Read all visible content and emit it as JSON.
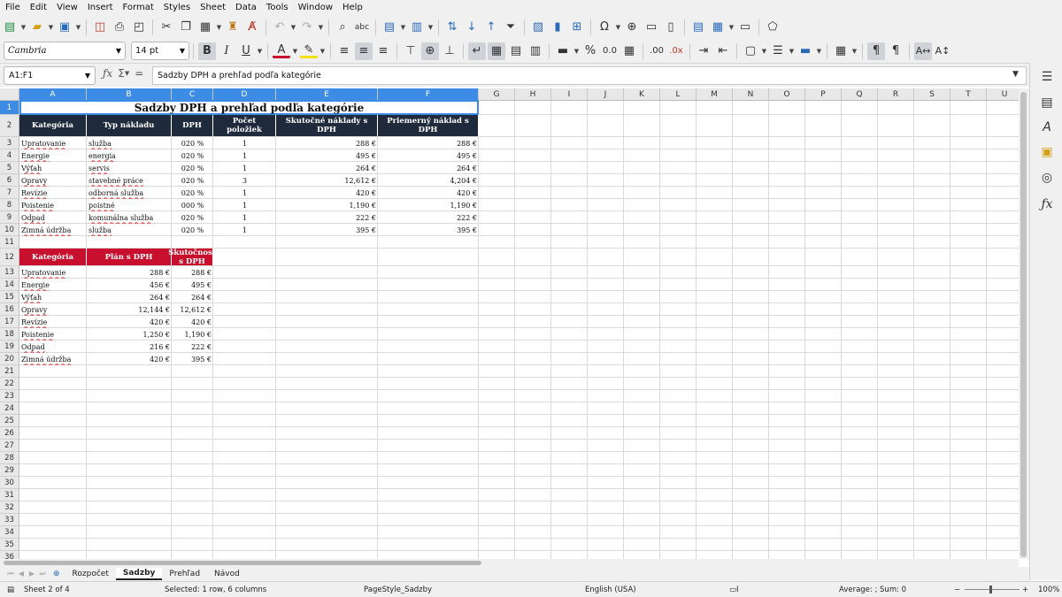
{
  "menu": [
    "File",
    "Edit",
    "View",
    "Insert",
    "Format",
    "Styles",
    "Sheet",
    "Data",
    "Tools",
    "Window",
    "Help"
  ],
  "font": {
    "name": "Cambria",
    "size": "14 pt"
  },
  "namebox": "A1:F1",
  "formula": "Sadzby DPH a prehľad podľa kategórie",
  "columns": [
    {
      "l": "A",
      "w": 76
    },
    {
      "l": "B",
      "w": 96
    },
    {
      "l": "C",
      "w": 47
    },
    {
      "l": "D",
      "w": 71
    },
    {
      "l": "E",
      "w": 115
    },
    {
      "l": "F",
      "w": 114
    },
    {
      "l": "G",
      "w": 41
    },
    {
      "l": "H",
      "w": 41
    },
    {
      "l": "I",
      "w": 41
    },
    {
      "l": "J",
      "w": 41
    },
    {
      "l": "K",
      "w": 41
    },
    {
      "l": "L",
      "w": 41
    },
    {
      "l": "M",
      "w": 41
    },
    {
      "l": "N",
      "w": 41
    },
    {
      "l": "O",
      "w": 41
    },
    {
      "l": "P",
      "w": 41
    },
    {
      "l": "Q",
      "w": 41
    },
    {
      "l": "R",
      "w": 41
    },
    {
      "l": "S",
      "w": 41
    },
    {
      "l": "T",
      "w": 41
    },
    {
      "l": "U",
      "w": 41
    }
  ],
  "title": "Sadzby DPH a prehľad podľa kategórie",
  "table1": {
    "headers": [
      "Kategória",
      "Typ nákladu",
      "DPH",
      "Počet položiek",
      "Skutočné náklady s DPH",
      "Priemerný náklad s DPH"
    ],
    "rows": [
      [
        "Upratovanie",
        "služba",
        "020 %",
        "1",
        "288 €",
        "288 €"
      ],
      [
        "Energie",
        "energia",
        "020 %",
        "1",
        "495 €",
        "495 €"
      ],
      [
        "Výťah",
        "servis",
        "020 %",
        "1",
        "264 €",
        "264 €"
      ],
      [
        "Opravy",
        "stavebné práce",
        "020 %",
        "3",
        "12,612 €",
        "4,204 €"
      ],
      [
        "Revízie",
        "odborná služba",
        "020 %",
        "1",
        "420 €",
        "420 €"
      ],
      [
        "Poistenie",
        "poistné",
        "000 %",
        "1",
        "1,190 €",
        "1,190 €"
      ],
      [
        "Odpad",
        "komunálna služba",
        "020 %",
        "1",
        "222 €",
        "222 €"
      ],
      [
        "Zimná údržba",
        "služba",
        "020 %",
        "1",
        "395 €",
        "395 €"
      ]
    ]
  },
  "table2": {
    "headers": [
      "Kategória",
      "Plán s DPH",
      "Skutočnosť s DPH"
    ],
    "rows": [
      [
        "Upratovanie",
        "288 €",
        "288 €"
      ],
      [
        "Energie",
        "456 €",
        "495 €"
      ],
      [
        "Výťah",
        "264 €",
        "264 €"
      ],
      [
        "Opravy",
        "12,144 €",
        "12,612 €"
      ],
      [
        "Revízie",
        "420 €",
        "420 €"
      ],
      [
        "Poistenie",
        "1,250 €",
        "1,190 €"
      ],
      [
        "Odpad",
        "216 €",
        "222 €"
      ],
      [
        "Zimná údržba",
        "420 €",
        "395 €"
      ]
    ]
  },
  "tabs": [
    "Rozpočet",
    "Sadzby",
    "Prehľad",
    "Návod"
  ],
  "active_tab": "Sadzby",
  "status": {
    "sheet": "Sheet 2 of 4",
    "selection": "Selected: 1 row, 6 columns",
    "style": "PageStyle_Sadzby",
    "lang": "English (USA)",
    "calc": "Average: ; Sum: 0",
    "zoom": "100%"
  },
  "colors": {
    "header_navy": "#1f2a3c",
    "header_red": "#c8102e",
    "selection": "#3c8ce6"
  }
}
